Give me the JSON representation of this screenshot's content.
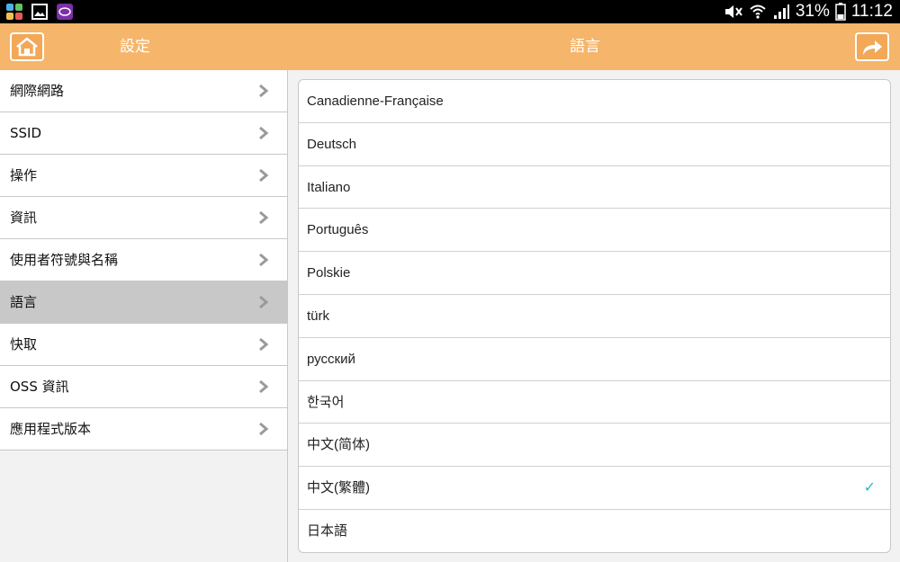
{
  "statusbar": {
    "battery_text": "31%",
    "time": "11:12",
    "left_icons": [
      "app-grid-icon",
      "gallery-icon",
      "purple-app-icon"
    ],
    "right_icons": [
      "mute-icon",
      "wifi-icon",
      "signal-icon",
      "battery-icon"
    ]
  },
  "header": {
    "left_title": "設定",
    "right_title": "語言",
    "home_icon": "home-icon",
    "share_icon": "share-arrow-icon",
    "color": "#f5b56a"
  },
  "sidebar": {
    "items": [
      {
        "label": "網際網路",
        "active": false
      },
      {
        "label": "SSID",
        "active": false
      },
      {
        "label": "操作",
        "active": false
      },
      {
        "label": "資訊",
        "active": false
      },
      {
        "label": "使用者符號與名稱",
        "active": false
      },
      {
        "label": "語言",
        "active": true
      },
      {
        "label": "快取",
        "active": false
      },
      {
        "label": "OSS 資訊",
        "active": false
      },
      {
        "label": "應用程式版本",
        "active": false
      }
    ]
  },
  "languages": {
    "items": [
      {
        "label": "Canadienne-Française",
        "selected": false
      },
      {
        "label": "Deutsch",
        "selected": false
      },
      {
        "label": "Italiano",
        "selected": false
      },
      {
        "label": "Português",
        "selected": false
      },
      {
        "label": "Polskie",
        "selected": false
      },
      {
        "label": "türk",
        "selected": false
      },
      {
        "label": "русский",
        "selected": false
      },
      {
        "label": "한국어",
        "selected": false
      },
      {
        "label": "中文(简体)",
        "selected": false
      },
      {
        "label": "中文(繁體)",
        "selected": true
      },
      {
        "label": "日本語",
        "selected": false
      }
    ],
    "check_mark": "✓",
    "check_color": "#2bb8c6"
  }
}
